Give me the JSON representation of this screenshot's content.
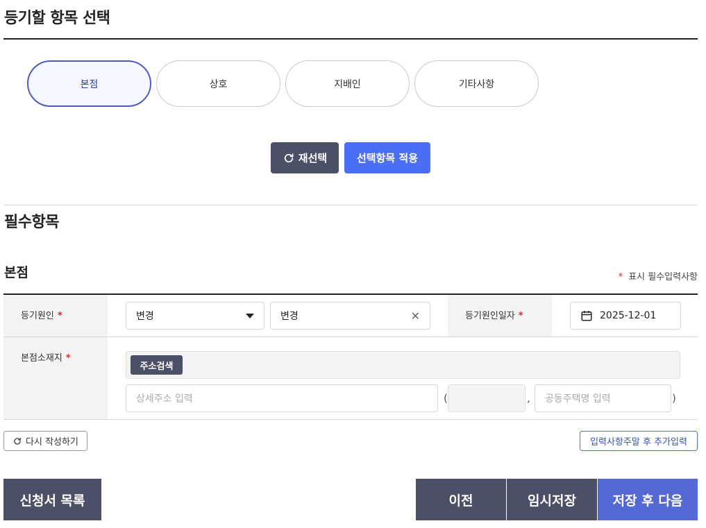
{
  "header": {
    "title": "등기할 항목 선택"
  },
  "selection": {
    "items": [
      {
        "label": "본점",
        "active": true
      },
      {
        "label": "상호",
        "active": false
      },
      {
        "label": "지배인",
        "active": false
      },
      {
        "label": "기타사항",
        "active": false
      }
    ],
    "reselect_label": "재선택",
    "apply_label": "선택항목 적용"
  },
  "required": {
    "title": "필수항목",
    "sub_title": "본점",
    "required_note_star": "*",
    "required_note": "표시 필수입력사항",
    "cause": {
      "label": "등기원인",
      "star": "*",
      "select_value": "변경",
      "input_value": "변경"
    },
    "cause_date": {
      "label": "등기원인일자",
      "star": "*",
      "value": "2025-12-01"
    },
    "location": {
      "label": "본점소재지",
      "star": "*",
      "search_label": "주소검색",
      "detail_placeholder": "상세주소 입력",
      "open_paren": "(",
      "comma": ",",
      "close_paren": ")",
      "apartment_placeholder": "공동주택명 입력"
    },
    "rewrite_label": "다시 작성하기",
    "add_input_label": "입력사항주말 후 추가입력"
  },
  "footer": {
    "list_label": "신청서 목록",
    "prev_label": "이전",
    "temp_save_label": "임시저장",
    "save_next_label": "저장 후 다음"
  },
  "colors": {
    "accent": "#4a6ef5",
    "dark_button": "#4b5066",
    "required_star": "#d62b3a",
    "active_pill_border": "#4a5cc2"
  }
}
